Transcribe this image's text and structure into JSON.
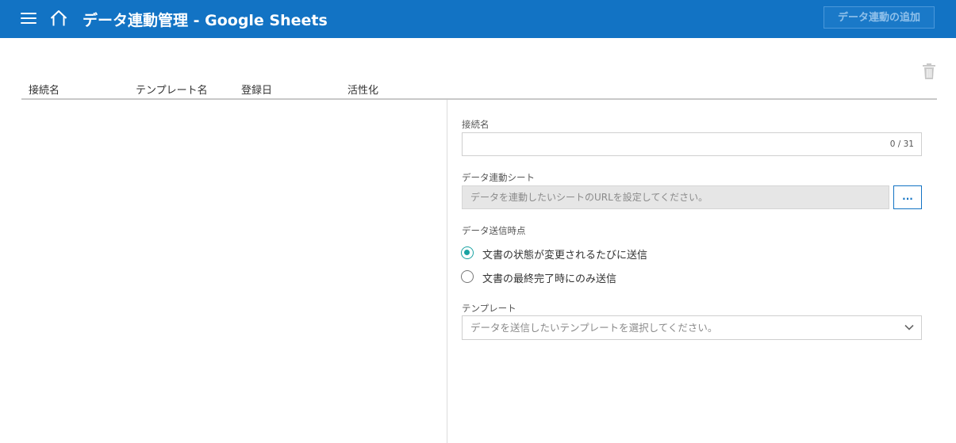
{
  "header": {
    "title": "データ連動管理 - Google Sheets",
    "add_button": "データ連動の追加",
    "icons": [
      "menu-icon",
      "home-icon"
    ],
    "accent_color": "#1273c4"
  },
  "toolbar": {
    "delete_icon": "trash-icon"
  },
  "table": {
    "columns": [
      "接続名",
      "テンプレート名",
      "登録日",
      "活性化"
    ],
    "rows": []
  },
  "form": {
    "connection_name": {
      "label": "接続名",
      "value": "",
      "counter": "0 / 31"
    },
    "sheet": {
      "label": "データ連動シート",
      "placeholder": "データを連動したいシートのURLを設定してください。",
      "browse_label": "..."
    },
    "send_timing": {
      "label": "データ送信時点",
      "options": [
        {
          "label": "文書の状態が変更されるたびに送信",
          "selected": true
        },
        {
          "label": "文書の最終完了時にのみ送信",
          "selected": false
        }
      ]
    },
    "template": {
      "label": "テンプレート",
      "placeholder": "データを送信したいテンプレートを選択してください。"
    },
    "radio_color": "#1aa3a3"
  }
}
